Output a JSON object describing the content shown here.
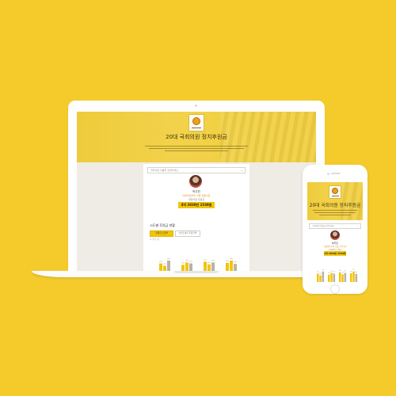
{
  "app": {
    "title": "20대 국회의원 정치후원금",
    "search_placeholder": "국회의원 이름을 검색하세요",
    "description_lines": 3
  },
  "politician": {
    "name": "박주민",
    "party_line": "더불어민주당 서울 은평구갑",
    "role": "국회의원 후원금",
    "amount": "4억 3830만 1539원"
  },
  "section": {
    "title": "시도별 후원금 현황",
    "tabs": [
      "후원금 모금액",
      "1인당 평균 후원금액"
    ],
    "note": "※ 단위: 원"
  },
  "colors": {
    "background": "#f5cb2c",
    "accent": "#f1c50d",
    "bar_dark": "#b8b2a6"
  },
  "icons": {
    "emblem": "assembly-emblem-icon",
    "search_chevron": "chevron-down-icon"
  },
  "chart_data": {
    "type": "bar",
    "categories": [
      "1",
      "2",
      "3",
      "4"
    ],
    "series": [
      {
        "values": [
          48,
          42,
          55,
          50
        ]
      },
      {
        "values": [
          38,
          52,
          44,
          60
        ]
      },
      {
        "values": [
          60,
          48,
          52,
          46
        ]
      }
    ],
    "ylim": [
      0,
      100
    ]
  }
}
